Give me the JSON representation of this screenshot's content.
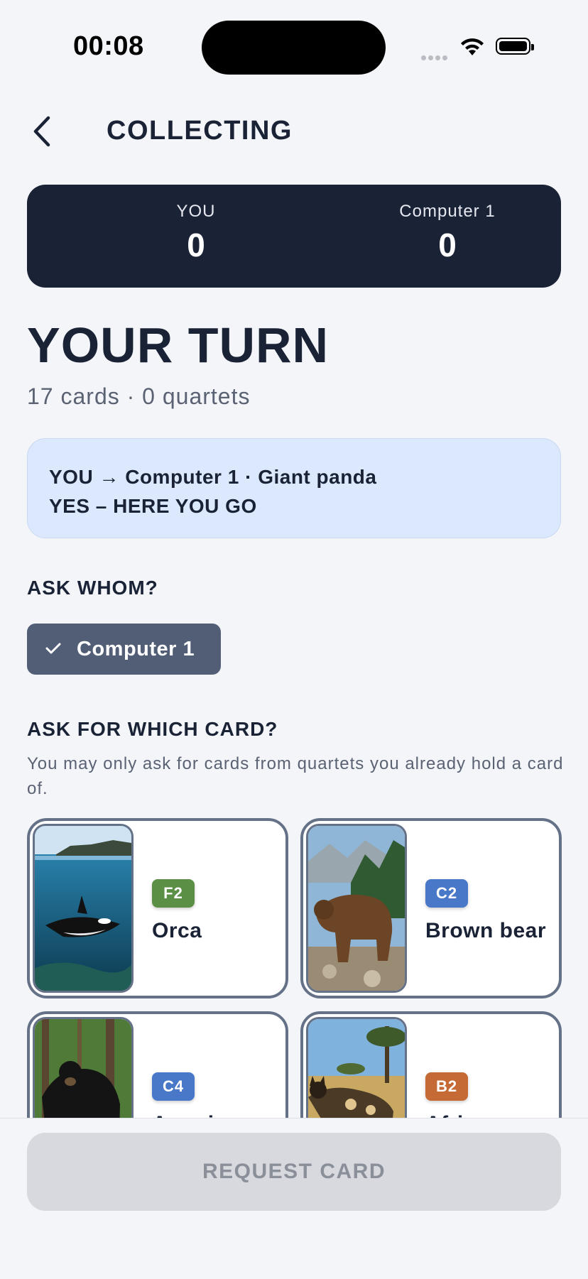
{
  "status_bar": {
    "time": "00:08"
  },
  "header": {
    "title": "COLLECTING"
  },
  "scoreboard": {
    "players": [
      {
        "name": "YOU",
        "score": "0"
      },
      {
        "name": "Computer 1",
        "score": "0"
      }
    ]
  },
  "turn": {
    "title": "YOUR TURN",
    "summary": "17 cards · 0 quartets"
  },
  "log": {
    "line1": "YOU → Computer 1 · Giant panda",
    "line2": "YES – HERE YOU GO"
  },
  "ask_whom": {
    "heading": "ASK WHOM?",
    "selected_player": "Computer 1"
  },
  "ask_card": {
    "heading": "ASK FOR WHICH CARD?",
    "hint": "You may only ask for cards from quartets you already hold a card of."
  },
  "cards": [
    {
      "code": "F2",
      "name": "Orca",
      "badge_color": "#5b8f45",
      "image": "orca-photo"
    },
    {
      "code": "C2",
      "name": "Brown bear",
      "badge_color": "#4a78c9",
      "image": "brown-bear-photo"
    },
    {
      "code": "C4",
      "name": "American",
      "badge_color": "#4a78c9",
      "image": "black-bear-photo"
    },
    {
      "code": "B2",
      "name": "African",
      "badge_color": "#c56a34",
      "image": "wild-dog-photo"
    }
  ],
  "footer": {
    "request_button": "REQUEST CARD"
  }
}
